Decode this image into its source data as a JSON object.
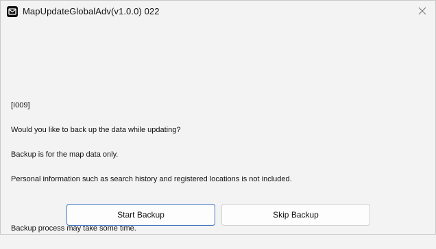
{
  "window": {
    "title": "MapUpdateGlobalAdv(v1.0.0) 022",
    "icon": "app-map-update-icon",
    "close_icon": "close-icon"
  },
  "message": {
    "code": "[I009]",
    "line1": "Would you like to back up the data while updating?",
    "line2": "Backup is for the map data only.",
    "line3": "Personal information such as search history and registered locations is not included.",
    "line4": "",
    "line5": "Backup process may take some time."
  },
  "buttons": {
    "start_backup": "Start Backup",
    "skip_backup": "Skip Backup"
  },
  "colors": {
    "background": "#f3f3f3",
    "primary_border": "#3c72bf",
    "button_border": "#d0d0d0"
  }
}
